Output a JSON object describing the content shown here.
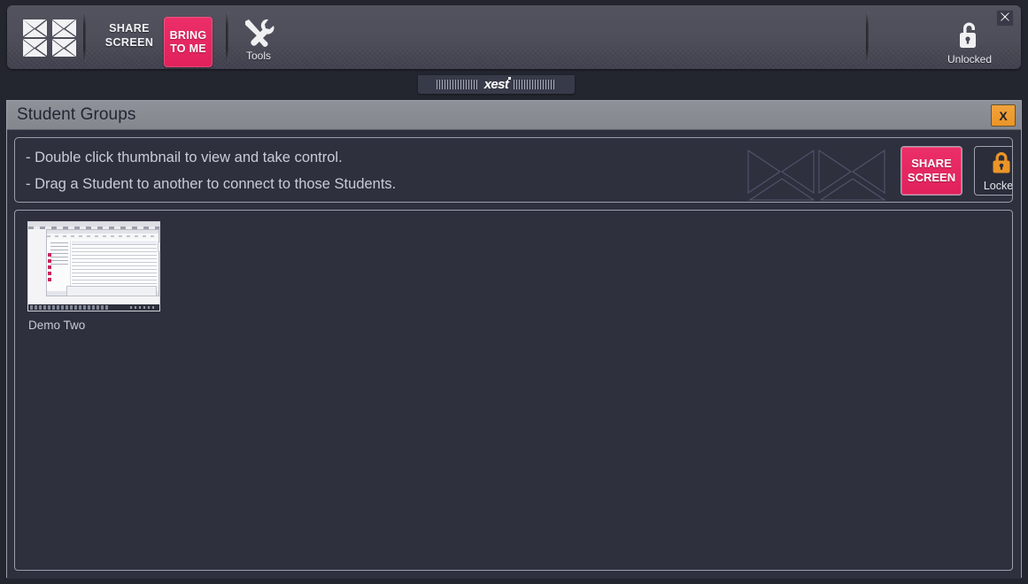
{
  "toolbar": {
    "logo_icon": "xest-x-logo-icon",
    "share_screen_label": "SHARE\nSCREEN",
    "bring_to_me_label": "BRING\nTO ME",
    "tools_label": "Tools",
    "tools_icon": "tools-wrench-screwdriver-icon",
    "lock_status_label": "Unlocked",
    "lock_status_icon": "padlock-open-icon",
    "close_icon": "close-x-icon",
    "accent_pink": "#e0215c",
    "background": "#4e4e5a"
  },
  "xest_tab": {
    "brand": "xest",
    "left_grip_icon": "grip-lines-icon",
    "right_grip_icon": "grip-lines-icon"
  },
  "window": {
    "title": "Student Groups",
    "close_label": "X",
    "close_button_color": "#eb9527",
    "titlebar_color": "#888a92"
  },
  "instructions": {
    "lines": [
      "- Double click thumbnail to view and take control.",
      "- Drag a Student to another to connect to those Students."
    ],
    "watermark_icon": "x-chevron-watermark-icon",
    "share_screen_label": "SHARE\nSCREEN",
    "lock_label": "Locked",
    "lock_icon": "padlock-closed-icon",
    "lock_color": "#eb9527"
  },
  "students": [
    {
      "name": "Demo Two",
      "thumbnail_icon": "student-desktop-thumbnail-icon"
    }
  ]
}
